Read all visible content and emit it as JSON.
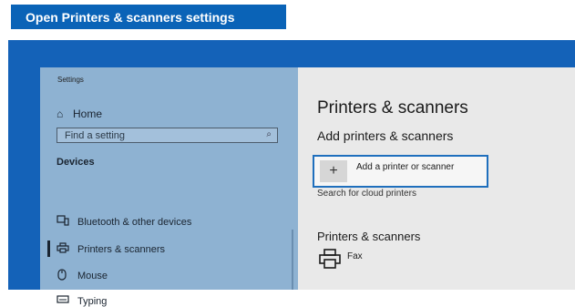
{
  "banner": {
    "text": "Open Printers & scanners settings"
  },
  "window": {
    "sidebar": {
      "title": "Settings",
      "home_label": "Home",
      "search_placeholder": "Find a setting",
      "section_label": "Devices",
      "items": [
        {
          "label": "Bluetooth & other devices",
          "icon": "bluetooth-devices-icon",
          "selected": false
        },
        {
          "label": "Printers & scanners",
          "icon": "printer-icon",
          "selected": true
        },
        {
          "label": "Mouse",
          "icon": "mouse-icon",
          "selected": false
        },
        {
          "label": "Typing",
          "icon": "keyboard-icon",
          "selected": false
        }
      ]
    },
    "content": {
      "page_title": "Printers & scanners",
      "add_heading": "Add printers & scanners",
      "add_button_label": "Add a printer or scanner",
      "cloud_link": "Search for cloud printers",
      "list_heading": "Printers & scanners",
      "printers": [
        {
          "name": "Fax",
          "icon": "printer-icon"
        }
      ]
    }
  },
  "colors": {
    "banner_bg": "#0a63b7",
    "frame_bg": "#1462b8",
    "sidebar_bg": "#8eb2d2",
    "content_bg": "#e9e9e9",
    "focus_border": "#1f6fbd"
  }
}
